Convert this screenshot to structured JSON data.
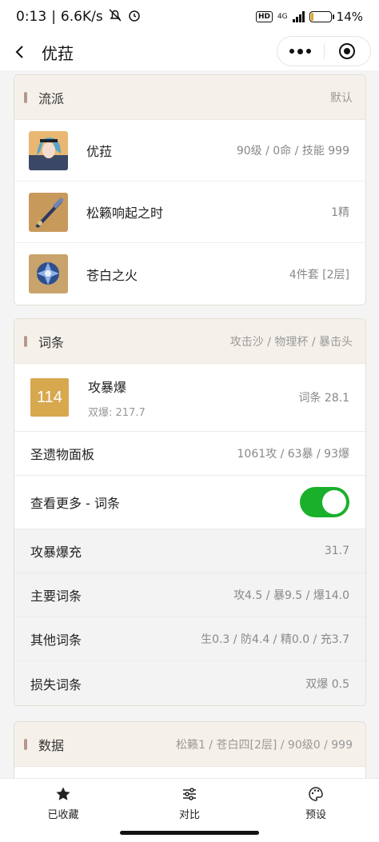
{
  "status": {
    "time": "0:13",
    "speed": "6.6K/s",
    "battery": "14%",
    "network": "4G",
    "hd": "HD",
    "battery_level": 0.14
  },
  "nav": {
    "title": "优菈"
  },
  "build": {
    "header": "流派",
    "header_right": "默认",
    "items": [
      {
        "name": "优菈",
        "value": "90级 / 0命 / 技能 999"
      },
      {
        "name": "松籁响起之时",
        "value": "1精"
      },
      {
        "name": "苍白之火",
        "value": "4件套 [2层]"
      }
    ]
  },
  "substats": {
    "header": "词条",
    "header_right": "攻击沙 / 物理杯 / 暴击头",
    "score": "114",
    "score_title": "攻暴爆",
    "score_sub": "双爆: 217.7",
    "score_right": "词条 28.1",
    "panel_label": "圣遗物面板",
    "panel_value": "1061攻 / 63暴 / 93爆",
    "more_label": "查看更多 - 词条",
    "more_enabled": true,
    "details": [
      {
        "label": "攻暴爆充",
        "value": "31.7"
      },
      {
        "label": "主要词条",
        "value": "攻4.5 / 暴9.5 / 爆14.0"
      },
      {
        "label": "其他词条",
        "value": "生0.3 / 防4.4 / 精0.0 / 充3.7"
      },
      {
        "label": "损失词条",
        "value": "双爆 0.5"
      }
    ]
  },
  "data_card": {
    "header": "数据",
    "header_right": "松籁1 / 苍白四[2层] / 90级0 / 999"
  },
  "tabbar": {
    "tabs": [
      {
        "label": "已收藏",
        "icon": "star-icon"
      },
      {
        "label": "对比",
        "icon": "sliders-icon"
      },
      {
        "label": "预设",
        "icon": "palette-icon"
      }
    ]
  }
}
